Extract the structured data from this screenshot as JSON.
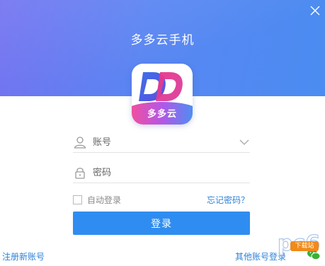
{
  "window": {
    "title": "多多云手机",
    "close_icon": "close-icon"
  },
  "logo": {
    "letters": "DD",
    "label": "多多云"
  },
  "form": {
    "account_placeholder": "账号",
    "password_placeholder": "密码",
    "remember_label": "自动登录",
    "forgot_label": "忘记密码？",
    "login_label": "登录"
  },
  "footer": {
    "register_label": "注册新账号",
    "other_login_label": "其他账号登录"
  },
  "watermark": {
    "text": "pc6",
    "badge": "下载站"
  },
  "colors": {
    "header_start": "#6f6ff0",
    "header_end": "#4a8cf1",
    "primary": "#2f8df1",
    "link": "#2f82d8",
    "logo_pink": "#e8388a",
    "logo_blue": "#3f6fe8"
  }
}
